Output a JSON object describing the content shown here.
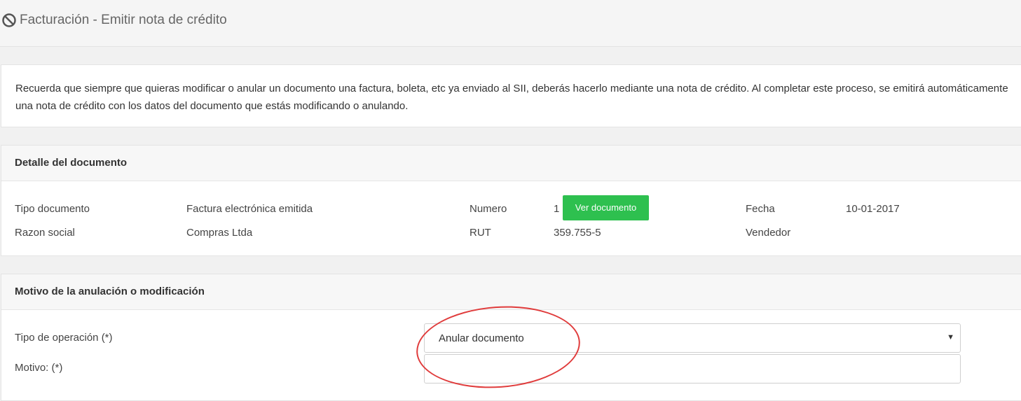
{
  "header": {
    "title": "Facturación - Emitir nota de crédito",
    "icon": "ban-icon"
  },
  "notice": {
    "text": "Recuerda que siempre que quieras modificar o anular un documento una factura, boleta, etc ya enviado al SII, deberás hacerlo mediante una nota de crédito. Al completar este proceso, se emitirá automáticamente una nota de crédito con los datos del documento que estás modificando o anulando."
  },
  "detail": {
    "title": "Detalle del documento",
    "tipo_label": "Tipo documento",
    "tipo_value": "Factura electrónica emitida",
    "numero_label": "Numero",
    "numero_value": "1",
    "ver_button": "Ver documento",
    "fecha_label": "Fecha",
    "fecha_value": "10-01-2017",
    "razon_label": "Razon social",
    "razon_value": "Compras Ltda",
    "rut_label": "RUT",
    "rut_value": "359.755-5",
    "vendedor_label": "Vendedor",
    "vendedor_value": ""
  },
  "motivo": {
    "title": "Motivo de la anulación o modificación",
    "operacion_label": "Tipo de operación (*)",
    "operacion_value": "Anular documento",
    "motivo_label": "Motivo: (*)",
    "motivo_value": ""
  },
  "colors": {
    "accent_button": "#2ec04f",
    "annotation": "#e03c3c"
  }
}
